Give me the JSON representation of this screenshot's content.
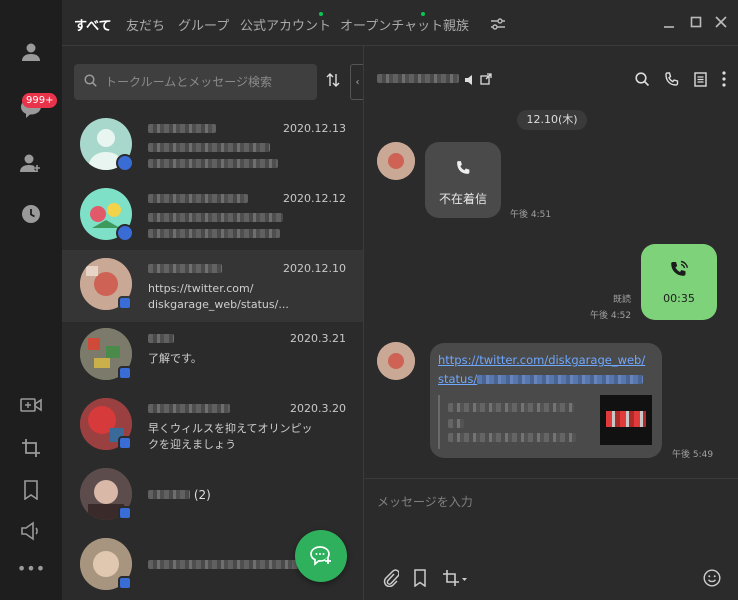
{
  "rail": {
    "unread_badge": "999+",
    "icons": [
      "person-icon",
      "chat-icon",
      "add-friend-icon",
      "clock-icon",
      "video-call-icon",
      "crop-icon",
      "bookmark-icon",
      "speaker-icon",
      "more-icon"
    ]
  },
  "tabs": [
    {
      "label": "すべて",
      "active": true
    },
    {
      "label": "友だち"
    },
    {
      "label": "グループ"
    },
    {
      "label": "公式アカウント",
      "dot": true
    },
    {
      "label": "オープンチャット",
      "dot": true
    },
    {
      "label": "親族"
    }
  ],
  "search": {
    "placeholder": "トークルームとメッセージ検索"
  },
  "chats": [
    {
      "date": "2020.12.13",
      "pinned": true
    },
    {
      "date": "2020.12.12",
      "pinned": true
    },
    {
      "date": "2020.12.10",
      "msg_line1": "https://twitter.com/",
      "msg_line2": "diskgarage_web/status/..."
    },
    {
      "date": "2020.3.21",
      "msg_line1": "了解です。"
    },
    {
      "date": "2020.3.20",
      "msg_line1": "早くウィルスを抑えてオリンピッ",
      "msg_line2": "クを迎えましょう"
    },
    {
      "name_suffix": "(2)"
    }
  ],
  "conversation": {
    "date_chip": "12.10(木)",
    "missed_call": {
      "label": "不在着信",
      "time": "午後 4:51"
    },
    "outgoing_call": {
      "duration": "00:35",
      "read": "既読",
      "time": "午後 4:52"
    },
    "link_message": {
      "line1": "https://twitter.com/diskgarage_web/",
      "line2": "status/",
      "time": "午後 5:49"
    },
    "composer_placeholder": "メッセージを入力"
  },
  "colors": {
    "accent_green": "#2fb05c",
    "bubble_green": "#7ed27a",
    "badge_red": "#e8334a",
    "link_blue": "#6fa8ff"
  }
}
